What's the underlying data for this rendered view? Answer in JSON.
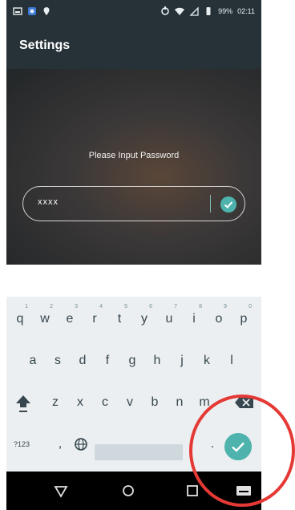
{
  "status_bar": {
    "battery_percent": "99%",
    "time": "02:11"
  },
  "app_bar": {
    "title": "Settings"
  },
  "main": {
    "prompt": "Please Input Password",
    "password": {
      "value": "xxxx"
    }
  },
  "keyboard": {
    "row1": [
      {
        "key": "q",
        "hint": "1"
      },
      {
        "key": "w",
        "hint": "2"
      },
      {
        "key": "e",
        "hint": "3"
      },
      {
        "key": "r",
        "hint": "4"
      },
      {
        "key": "t",
        "hint": "5"
      },
      {
        "key": "y",
        "hint": "6"
      },
      {
        "key": "u",
        "hint": "7"
      },
      {
        "key": "i",
        "hint": "8"
      },
      {
        "key": "o",
        "hint": "9"
      },
      {
        "key": "p",
        "hint": "0"
      }
    ],
    "row2": [
      "a",
      "s",
      "d",
      "f",
      "g",
      "h",
      "j",
      "k",
      "l"
    ],
    "row3": [
      "z",
      "x",
      "c",
      "v",
      "b",
      "n",
      "m"
    ],
    "row4": {
      "symbols": "?123",
      "comma": ",",
      "period": "."
    }
  },
  "colors": {
    "accent": "#4fb3ad",
    "status_bar": "#263238",
    "annotation": "#e53935"
  },
  "icons": {
    "status_left": [
      "image-icon",
      "app-icon",
      "location-pin-icon"
    ],
    "status_right": [
      "sync-icon",
      "wifi-icon",
      "sim-icon",
      "battery-icon"
    ],
    "nav": [
      "back-icon",
      "home-icon",
      "recents-icon",
      "keyboard-switch-icon"
    ]
  }
}
